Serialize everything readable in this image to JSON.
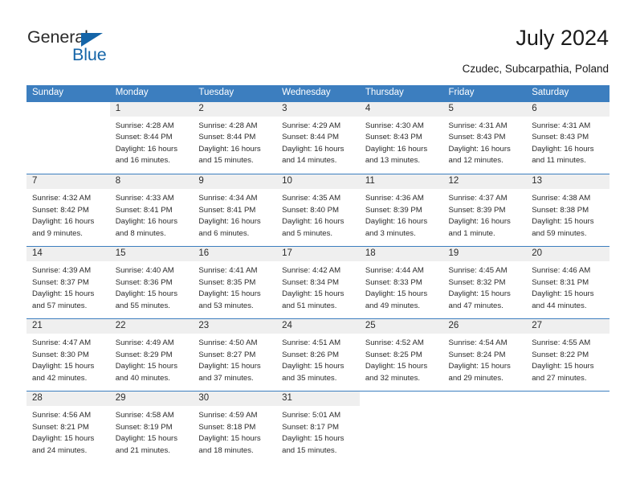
{
  "brand": {
    "name_top": "General",
    "name_bottom": "Blue",
    "triangle_icon": "triangle-icon",
    "accent_color": "#1565a8"
  },
  "header": {
    "title": "July 2024",
    "subtitle": "Czudec, Subcarpathia, Poland"
  },
  "theme": {
    "header_bg": "#3c7ebf",
    "header_text": "#ffffff",
    "daynum_bg": "#efefef",
    "cell_bg": "#ffffff",
    "text": "#2b2b2b",
    "rule": "#3c7ebf"
  },
  "weekday_headers": [
    "Sunday",
    "Monday",
    "Tuesday",
    "Wednesday",
    "Thursday",
    "Friday",
    "Saturday"
  ],
  "weeks": [
    [
      {
        "day": "",
        "lines": []
      },
      {
        "day": "1",
        "lines": [
          "Sunrise: 4:28 AM",
          "Sunset: 8:44 PM",
          "Daylight: 16 hours",
          "and 16 minutes."
        ]
      },
      {
        "day": "2",
        "lines": [
          "Sunrise: 4:28 AM",
          "Sunset: 8:44 PM",
          "Daylight: 16 hours",
          "and 15 minutes."
        ]
      },
      {
        "day": "3",
        "lines": [
          "Sunrise: 4:29 AM",
          "Sunset: 8:44 PM",
          "Daylight: 16 hours",
          "and 14 minutes."
        ]
      },
      {
        "day": "4",
        "lines": [
          "Sunrise: 4:30 AM",
          "Sunset: 8:43 PM",
          "Daylight: 16 hours",
          "and 13 minutes."
        ]
      },
      {
        "day": "5",
        "lines": [
          "Sunrise: 4:31 AM",
          "Sunset: 8:43 PM",
          "Daylight: 16 hours",
          "and 12 minutes."
        ]
      },
      {
        "day": "6",
        "lines": [
          "Sunrise: 4:31 AM",
          "Sunset: 8:43 PM",
          "Daylight: 16 hours",
          "and 11 minutes."
        ]
      }
    ],
    [
      {
        "day": "7",
        "lines": [
          "Sunrise: 4:32 AM",
          "Sunset: 8:42 PM",
          "Daylight: 16 hours",
          "and 9 minutes."
        ]
      },
      {
        "day": "8",
        "lines": [
          "Sunrise: 4:33 AM",
          "Sunset: 8:41 PM",
          "Daylight: 16 hours",
          "and 8 minutes."
        ]
      },
      {
        "day": "9",
        "lines": [
          "Sunrise: 4:34 AM",
          "Sunset: 8:41 PM",
          "Daylight: 16 hours",
          "and 6 minutes."
        ]
      },
      {
        "day": "10",
        "lines": [
          "Sunrise: 4:35 AM",
          "Sunset: 8:40 PM",
          "Daylight: 16 hours",
          "and 5 minutes."
        ]
      },
      {
        "day": "11",
        "lines": [
          "Sunrise: 4:36 AM",
          "Sunset: 8:39 PM",
          "Daylight: 16 hours",
          "and 3 minutes."
        ]
      },
      {
        "day": "12",
        "lines": [
          "Sunrise: 4:37 AM",
          "Sunset: 8:39 PM",
          "Daylight: 16 hours",
          "and 1 minute."
        ]
      },
      {
        "day": "13",
        "lines": [
          "Sunrise: 4:38 AM",
          "Sunset: 8:38 PM",
          "Daylight: 15 hours",
          "and 59 minutes."
        ]
      }
    ],
    [
      {
        "day": "14",
        "lines": [
          "Sunrise: 4:39 AM",
          "Sunset: 8:37 PM",
          "Daylight: 15 hours",
          "and 57 minutes."
        ]
      },
      {
        "day": "15",
        "lines": [
          "Sunrise: 4:40 AM",
          "Sunset: 8:36 PM",
          "Daylight: 15 hours",
          "and 55 minutes."
        ]
      },
      {
        "day": "16",
        "lines": [
          "Sunrise: 4:41 AM",
          "Sunset: 8:35 PM",
          "Daylight: 15 hours",
          "and 53 minutes."
        ]
      },
      {
        "day": "17",
        "lines": [
          "Sunrise: 4:42 AM",
          "Sunset: 8:34 PM",
          "Daylight: 15 hours",
          "and 51 minutes."
        ]
      },
      {
        "day": "18",
        "lines": [
          "Sunrise: 4:44 AM",
          "Sunset: 8:33 PM",
          "Daylight: 15 hours",
          "and 49 minutes."
        ]
      },
      {
        "day": "19",
        "lines": [
          "Sunrise: 4:45 AM",
          "Sunset: 8:32 PM",
          "Daylight: 15 hours",
          "and 47 minutes."
        ]
      },
      {
        "day": "20",
        "lines": [
          "Sunrise: 4:46 AM",
          "Sunset: 8:31 PM",
          "Daylight: 15 hours",
          "and 44 minutes."
        ]
      }
    ],
    [
      {
        "day": "21",
        "lines": [
          "Sunrise: 4:47 AM",
          "Sunset: 8:30 PM",
          "Daylight: 15 hours",
          "and 42 minutes."
        ]
      },
      {
        "day": "22",
        "lines": [
          "Sunrise: 4:49 AM",
          "Sunset: 8:29 PM",
          "Daylight: 15 hours",
          "and 40 minutes."
        ]
      },
      {
        "day": "23",
        "lines": [
          "Sunrise: 4:50 AM",
          "Sunset: 8:27 PM",
          "Daylight: 15 hours",
          "and 37 minutes."
        ]
      },
      {
        "day": "24",
        "lines": [
          "Sunrise: 4:51 AM",
          "Sunset: 8:26 PM",
          "Daylight: 15 hours",
          "and 35 minutes."
        ]
      },
      {
        "day": "25",
        "lines": [
          "Sunrise: 4:52 AM",
          "Sunset: 8:25 PM",
          "Daylight: 15 hours",
          "and 32 minutes."
        ]
      },
      {
        "day": "26",
        "lines": [
          "Sunrise: 4:54 AM",
          "Sunset: 8:24 PM",
          "Daylight: 15 hours",
          "and 29 minutes."
        ]
      },
      {
        "day": "27",
        "lines": [
          "Sunrise: 4:55 AM",
          "Sunset: 8:22 PM",
          "Daylight: 15 hours",
          "and 27 minutes."
        ]
      }
    ],
    [
      {
        "day": "28",
        "lines": [
          "Sunrise: 4:56 AM",
          "Sunset: 8:21 PM",
          "Daylight: 15 hours",
          "and 24 minutes."
        ]
      },
      {
        "day": "29",
        "lines": [
          "Sunrise: 4:58 AM",
          "Sunset: 8:19 PM",
          "Daylight: 15 hours",
          "and 21 minutes."
        ]
      },
      {
        "day": "30",
        "lines": [
          "Sunrise: 4:59 AM",
          "Sunset: 8:18 PM",
          "Daylight: 15 hours",
          "and 18 minutes."
        ]
      },
      {
        "day": "31",
        "lines": [
          "Sunrise: 5:01 AM",
          "Sunset: 8:17 PM",
          "Daylight: 15 hours",
          "and 15 minutes."
        ]
      },
      {
        "day": "",
        "lines": []
      },
      {
        "day": "",
        "lines": []
      },
      {
        "day": "",
        "lines": []
      }
    ]
  ]
}
